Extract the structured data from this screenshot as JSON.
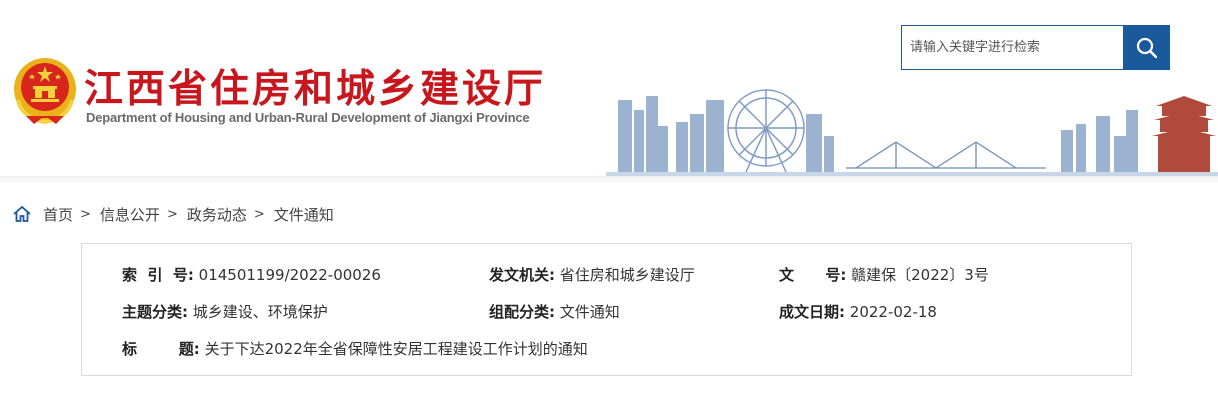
{
  "header": {
    "title": "江西省住房和城乡建设厅",
    "subtitle": "Department of Housing and Urban-Rural Development of Jiangxi Province",
    "emblem_icon": "national-emblem-icon",
    "search": {
      "placeholder": "请输入关键字进行检索",
      "value": "",
      "button_icon": "search-icon"
    }
  },
  "breadcrumb": {
    "icon": "home-icon",
    "items": [
      "首页",
      "信息公开",
      "政务动态",
      "文件通知"
    ],
    "separator": ">"
  },
  "document_info": {
    "index_no": {
      "label": "索  引  号:",
      "value": "014501199/2022-00026"
    },
    "issuer": {
      "label": "发文机关:",
      "value": "省住房和城乡建设厅"
    },
    "doc_no": {
      "label": "文      号:",
      "value": "赣建保〔2022〕3号"
    },
    "topic": {
      "label": "主题分类:",
      "value": "城乡建设、环境保护"
    },
    "category": {
      "label": "组配分类:",
      "value": "文件通知"
    },
    "date": {
      "label": "成文日期:",
      "value": "2022-02-18"
    },
    "title": {
      "label": "标        题:",
      "value": "关于下达2022年全省保障性安居工程建设工作计划的通知"
    }
  },
  "colors": {
    "brand_red": "#c8161d",
    "brand_blue": "#1a5a9c",
    "gold": "#e9b21a"
  }
}
